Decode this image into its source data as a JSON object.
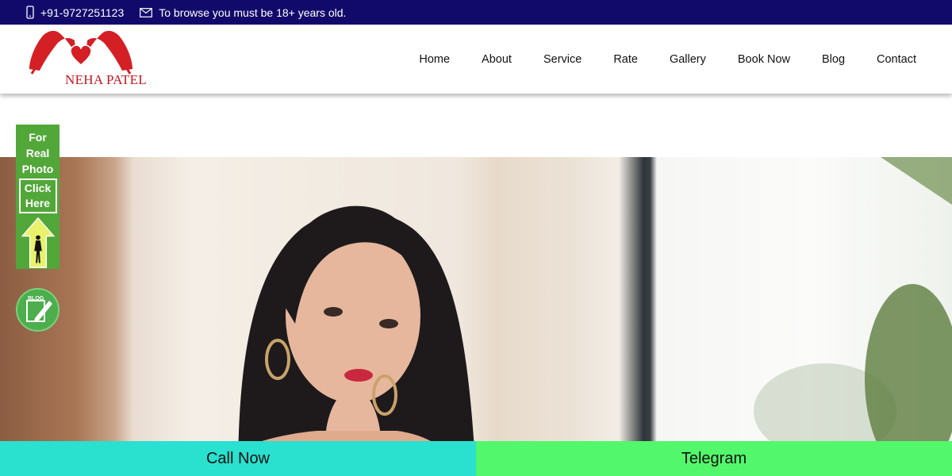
{
  "topbar": {
    "phone": "+91-9727251123",
    "notice": "To browse you must be 18+ years old.",
    "icons": [
      "mobile-phone-icon",
      "envelope-icon"
    ],
    "bg_color": "#120a6b"
  },
  "logo": {
    "text": "NEHA PATEL",
    "color": "#c5161d"
  },
  "nav": {
    "items": [
      "Home",
      "About",
      "Service",
      "Rate",
      "Gallery",
      "Book Now",
      "Blog",
      "Contact"
    ]
  },
  "promo": {
    "lines": [
      "For",
      "Real",
      "Photo"
    ],
    "click": [
      "Click",
      "Here"
    ],
    "color": "#52a739"
  },
  "blog_badge": {
    "text": "BLOG",
    "icon": "blog-pencil-icon"
  },
  "bottom_bar": {
    "call_label": "Call Now",
    "telegram_label": "Telegram",
    "call_color": "#2ae0cf",
    "telegram_color": "#53f76b"
  }
}
